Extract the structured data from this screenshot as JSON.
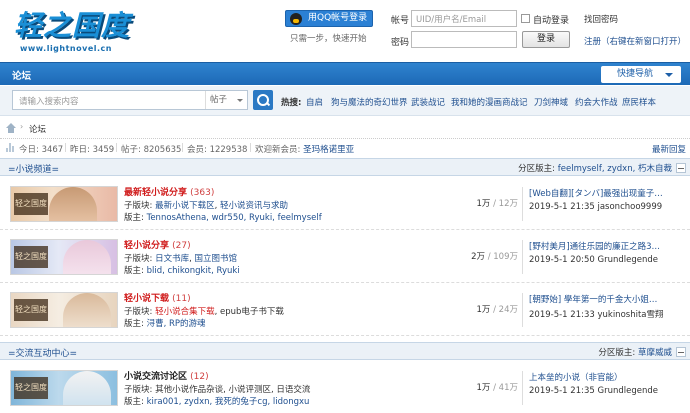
{
  "header": {
    "logo_text": "轻之国度",
    "logo_url": "www.lightnovel.cn",
    "qq_login": "用QQ帐号登录",
    "qq_sub": "只需一步，快速开始",
    "account_label": "帐号",
    "account_placeholder": "UID/用户名/Email",
    "auto_login": "自动登录",
    "find_password": "找回密码",
    "password_label": "密码",
    "login_button": "登录",
    "register": "注册（右键在新窗口打开）"
  },
  "nav": {
    "tab": "论坛",
    "quick_nav": "快捷导航"
  },
  "search": {
    "placeholder": "请输入搜索内容",
    "type": "帖子",
    "hot_label": "热搜:",
    "hot_items": [
      "自启",
      "狗与魔法的奇幻世界",
      "武装战记",
      "我和她的漫画商战记",
      "刀剑神域",
      "约会大作战",
      "庶民样本"
    ]
  },
  "breadcrumb": {
    "current": "论坛"
  },
  "stats": {
    "today": "今日: 3467",
    "yesterday": "昨日: 3459",
    "posts": "帖子: 8205635",
    "members": "会员: 1229538",
    "welcome_label": "欢迎新会员: ",
    "welcome_user": "圣玛格诺里亚",
    "latest_reply": "最新回复"
  },
  "sections": [
    {
      "title": "=小说频道=",
      "mods_label": "分区版主: ",
      "mods": "feelmyself, zydxn, 朽木自裁",
      "forums": [
        {
          "title": "最新轻小说分享",
          "count": "(363)",
          "sub_label": "子版块: ",
          "subs": [
            "最新小说下载区",
            "轻小说资讯与求助"
          ],
          "mod_label": "版主: ",
          "mods": "TennosAthena, wdr550, Ryuki, feelmyself",
          "stat_main": "1万",
          "stat_total": " / 12万",
          "last_title": "[Web自翻][タンバ]最强出现童子…",
          "last_meta": "2019-5-1 21:35 jasonchoo9999",
          "thumb_badge": "轻之国度"
        },
        {
          "title": "轻小说分享",
          "count": "(27)",
          "sub_label": "子版块: ",
          "subs": [
            "日文书库",
            "国立图书馆"
          ],
          "mod_label": "版主: ",
          "mods": "blid, chikongkit, Ryuki",
          "stat_main": "2万",
          "stat_total": " / 109万",
          "last_title": "[野村美月]通往乐园的廉正之路3…",
          "last_meta": "2019-5-1 20:50 Grundlegende",
          "thumb_badge": "轻之国度"
        },
        {
          "title": "轻小说下载",
          "count": "(11)",
          "sub_label": "子版块: ",
          "subs": [
            "轻小说合集下载"
          ],
          "sub_extra": ", epub电子书下载",
          "mod_label": "版主: ",
          "mods": "浔曹, RP的游魂",
          "stat_main": "1万",
          "stat_total": " / 24万",
          "last_title": "[朝野始] 學年第一的千金大小姐…",
          "last_meta": "2019-5-1 21:33 yukinoshita雪翔",
          "thumb_badge": "轻之国度"
        }
      ]
    },
    {
      "title": "=交流互动中心=",
      "mods_label": "分区版主: ",
      "mods": "草摩威威",
      "forums": [
        {
          "title": "小说交流讨论区",
          "count": "(12)",
          "sub_label": "子版块: ",
          "subs_plain": "其他小说作品杂谈, 小说评测区, 日语交流",
          "mod_label": "版主: ",
          "mods": "kira001, zydxn, 我死的兔子cg, lidongxu",
          "stat_main": "1万",
          "stat_total": " / 41万",
          "last_title": "上本垒的小说（非官能）",
          "last_meta": "2019-5-1 21:35 Grundlegende",
          "thumb_badge": "轻之国度"
        }
      ]
    }
  ],
  "colors": {
    "nav_blue": "#1d69b6",
    "link": "#1f4f8f",
    "red": "#d01c1c"
  }
}
